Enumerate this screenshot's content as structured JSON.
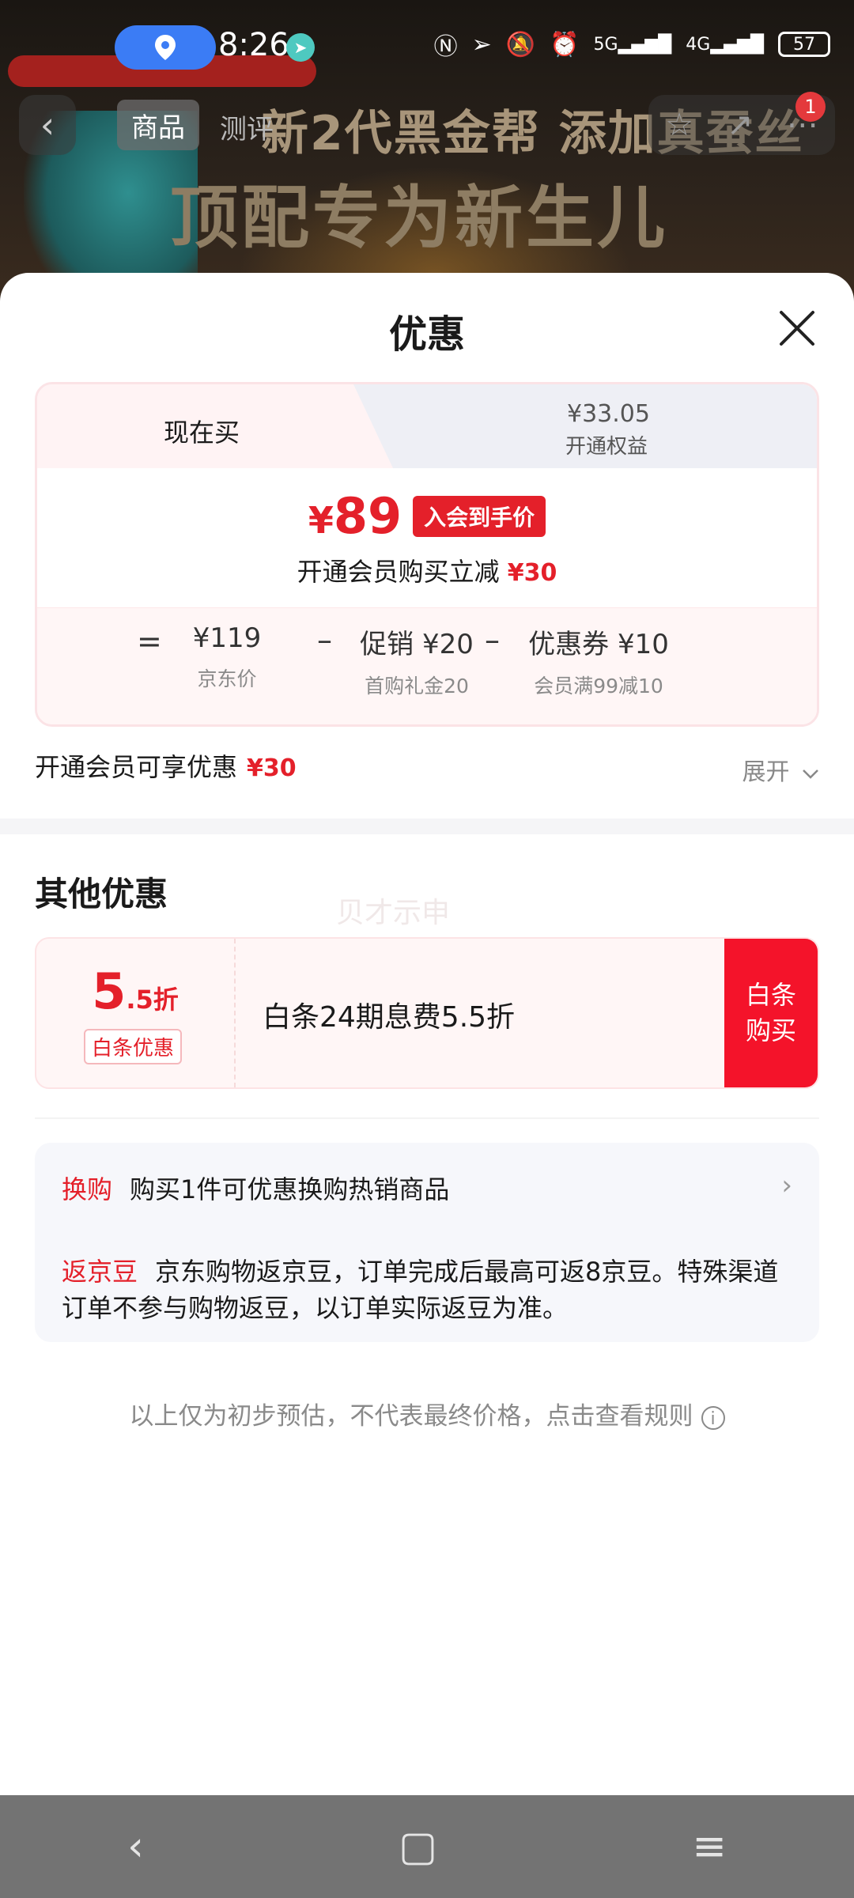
{
  "status_bar": {
    "time": "8:26",
    "battery": "57",
    "net1": "5G",
    "net2": "4G"
  },
  "banner": {
    "line1": "新2代黑金帮 添加真蚕丝",
    "line2": "顶配专为新生儿"
  },
  "nav": {
    "tab_product": "商品",
    "tab_review": "测评",
    "badge_count": "1"
  },
  "sheet": {
    "title": "优惠",
    "tabs": {
      "buy_now": "现在买",
      "benefit_price": "¥33.05",
      "benefit_label": "开通权益"
    },
    "price": {
      "value": "89",
      "yen": "¥",
      "tag": "入会到手价",
      "member_text": "开通会员购买立减",
      "member_amount": "¥30"
    },
    "breakdown": {
      "eq": "=",
      "minus": "–",
      "jd_price": "¥119",
      "jd_price_label": "京东价",
      "promo": "促销 ¥20",
      "promo_label": "首购礼金20",
      "coupon": "优惠券 ¥10",
      "coupon_label": "会员满99减10"
    },
    "member_benefit": {
      "text": "开通会员可享优惠",
      "amount": "¥30",
      "expand": "展开"
    },
    "other": {
      "title": "其他优惠",
      "watermark": "贝才示申",
      "baitiao": {
        "discount_big": "5",
        "discount_small": ".5折",
        "tag": "白条优惠",
        "text": "白条24期息费5.5折",
        "button_line1": "白条",
        "button_line2": "购买"
      }
    },
    "info": {
      "swap_tag": "换购",
      "swap_text": "购买1件可优惠换购热销商品",
      "beans_tag": "返京豆",
      "beans_text": "京东购物返京豆，订单完成后最高可返8京豆。特殊渠道订单不参与购物返豆，以订单实际返豆为准。"
    },
    "disclaimer": "以上仅为初步预估，不代表最终价格，点击查看规则"
  }
}
